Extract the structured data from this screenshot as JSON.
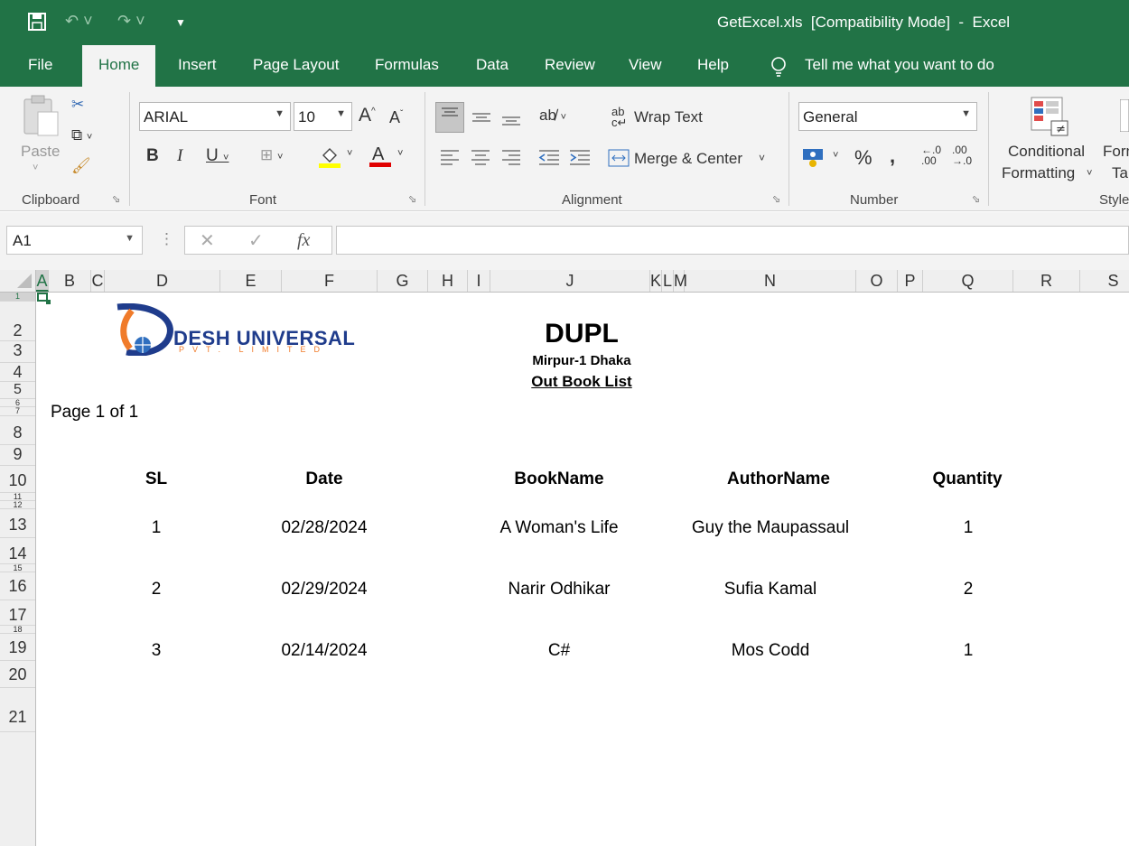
{
  "window": {
    "title": "GetExcel.xls  [Compatibility Mode]  -  Excel"
  },
  "tabs": [
    "File",
    "Home",
    "Insert",
    "Page Layout",
    "Formulas",
    "Data",
    "Review",
    "View",
    "Help"
  ],
  "tell_me": "Tell me what you want to do",
  "ribbon": {
    "paste_label": "Paste",
    "clipboard_label": "Clipboard",
    "font_name": "ARIAL",
    "font_size": "10",
    "font_label": "Font",
    "alignment_label": "Alignment",
    "wrap_text": "Wrap Text",
    "merge_center": "Merge & Center",
    "number_format": "General",
    "number_label": "Number",
    "conditional_line1": "Conditional",
    "conditional_line2": "Formatting",
    "format_as_table_partial": "Form",
    "format_as_table_partial2": "Tal",
    "styles_partial": "Style",
    "accent_color": "#217346"
  },
  "formula_bar": {
    "name_box": "A1",
    "fx": "fx",
    "content": ""
  },
  "columns": [
    "A",
    "B",
    "C",
    "D",
    "E",
    "F",
    "G",
    "H",
    "I",
    "J",
    "K",
    "L",
    "M",
    "N",
    "O",
    "P",
    "Q",
    "R",
    "S"
  ],
  "rows": [
    "1",
    "2",
    "3",
    "4",
    "5",
    "6",
    "7",
    "8",
    "9",
    "10",
    "11",
    "12",
    "13",
    "14",
    "15",
    "16",
    "17",
    "18",
    "19",
    "20",
    "21"
  ],
  "report": {
    "logo_text": "DESH UNIVERSAL",
    "logo_subtext": "PVT. LIMITED",
    "title": "DUPL",
    "subtitle": "Mirpur-1 Dhaka",
    "report_name": "Out Book List",
    "page_info": "Page 1 of 1",
    "headers": {
      "sl": "SL",
      "date": "Date",
      "book": "BookName",
      "author": "AuthorName",
      "qty": "Quantity"
    },
    "rows": [
      {
        "sl": "1",
        "date": "02/28/2024",
        "book": "A Woman's Life",
        "author": "Guy the Maupassaul",
        "qty": "1"
      },
      {
        "sl": "2",
        "date": "02/29/2024",
        "book": "Narir Odhikar",
        "author": "Sufia Kamal",
        "qty": "2"
      },
      {
        "sl": "3",
        "date": "02/14/2024",
        "book": "C#",
        "author": "Mos Codd",
        "qty": "1"
      }
    ]
  }
}
